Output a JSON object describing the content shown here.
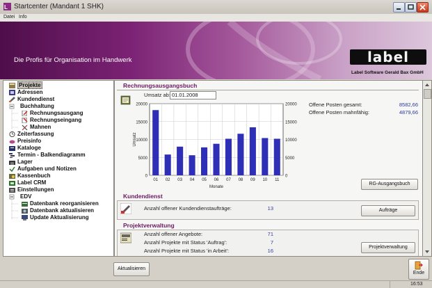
{
  "window": {
    "title": "Startcenter (Mandant 1 SHK)"
  },
  "menubar": {
    "items": [
      "Datei",
      "Info"
    ]
  },
  "banner": {
    "slogan": "Die Profis für Organisation im Handwerk",
    "logo_text": "label",
    "company": "Label Software Gerald Bax GmbH"
  },
  "tree": {
    "items": [
      {
        "label": "Projekte",
        "icon": "projects-icon"
      },
      {
        "label": "Adressen",
        "icon": "address-book-icon"
      },
      {
        "label": "Kundendienst",
        "icon": "customer-service-icon"
      },
      {
        "label": "Buchhaltung",
        "icon": "folder-icon"
      },
      {
        "label": "Rechnungsausgang",
        "icon": "invoice-out-icon"
      },
      {
        "label": "Rechnungseingang",
        "icon": "invoice-in-icon"
      },
      {
        "label": "Mahnen",
        "icon": "reminder-icon"
      },
      {
        "label": "Zeiterfassung",
        "icon": "clock-icon"
      },
      {
        "label": "Preisinfo",
        "icon": "price-icon"
      },
      {
        "label": "Kataloge",
        "icon": "catalog-icon"
      },
      {
        "label": "Termin - Balkendiagramm",
        "icon": "gantt-icon"
      },
      {
        "label": "Lager",
        "icon": "warehouse-icon"
      },
      {
        "label": "Aufgaben und Notizen",
        "icon": "tasks-icon"
      },
      {
        "label": "Kassenbuch",
        "icon": "cashbook-icon"
      },
      {
        "label": "Label CRM",
        "icon": "crm-icon"
      },
      {
        "label": "Einstellungen",
        "icon": "settings-icon"
      },
      {
        "label": "EDV",
        "icon": "folder-icon"
      },
      {
        "label": "Datenbank reorganisieren",
        "icon": "database-icon"
      },
      {
        "label": "Datenbank aktualisieren",
        "icon": "database-update-icon"
      },
      {
        "label": "Update Aktualisierung",
        "icon": "update-icon"
      }
    ]
  },
  "rechnungsausgangsbuch": {
    "title": "Rechnungsausgangsbuch",
    "umsatz_label": "Umsatz ab:",
    "umsatz_date": "01.01.2008",
    "offene_posten_label": "Offene Posten gesamt:",
    "offene_posten_value": "8582,66",
    "mahnfaehig_label": "Offene Posten mahnfähig:",
    "mahnfaehig_value": "4879,66",
    "button": "RG-Ausgangsbuch"
  },
  "chart_data": {
    "type": "bar",
    "categories": [
      "01",
      "02",
      "03",
      "04",
      "05",
      "06",
      "07",
      "08",
      "09",
      "10",
      "11"
    ],
    "values": [
      18200,
      5800,
      8000,
      5600,
      7800,
      8800,
      10200,
      11600,
      13400,
      10400,
      10200
    ],
    "xlabel": "Monate",
    "ylabel": "Umsatz",
    "ylim": [
      0,
      20000
    ],
    "yticks": [
      "0",
      "5000",
      "10000",
      "15000",
      "20000"
    ],
    "grid": true,
    "bar_color": "#2e2fb6"
  },
  "kundendienst": {
    "title": "Kundendienst",
    "label": "Anzahl offener Kundendienstaufträge:",
    "value": "13",
    "button": "Aufträge"
  },
  "projektverwaltung": {
    "title": "Projektverwaltung",
    "rows": [
      {
        "label": "Anzahl offener Angebote:",
        "value": "71"
      },
      {
        "label": "Anzahl Projekte mit Status 'Auftrag':",
        "value": "7"
      },
      {
        "label": "Anzahl Projekte mit Status 'in Arbeit':",
        "value": "16"
      }
    ],
    "button": "Projektverwaltung"
  },
  "bottom": {
    "refresh_button": "Aktualisieren",
    "end_button": "Ende"
  },
  "status": {
    "time": "16:53"
  }
}
